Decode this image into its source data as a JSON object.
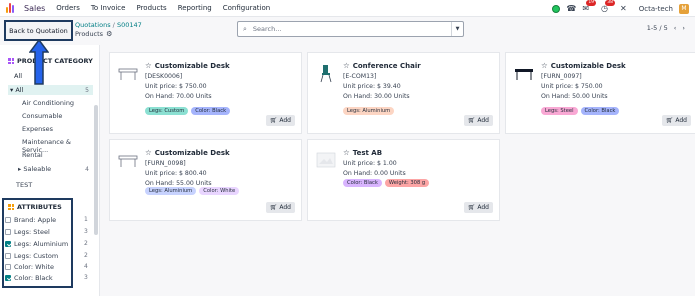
{
  "topbar": {
    "app_name": "Sales",
    "menus": [
      "Orders",
      "To Invoice",
      "Products",
      "Reporting",
      "Configuration"
    ],
    "messages_badge": "19",
    "activity_badge": "38",
    "company": "Octa-tech",
    "avatar_letter": "M"
  },
  "breadcrumb": {
    "parent": "Quotations",
    "separator": "/",
    "current": "S00147",
    "subtitle": "Products"
  },
  "back_button": {
    "label": "Back to Quotation"
  },
  "search": {
    "placeholder": "Search..."
  },
  "pager": {
    "value": "1-5 / 5",
    "prev": "‹",
    "next": "›"
  },
  "sidebar": {
    "category_title": "PRODUCT CATEGORY",
    "categories": [
      {
        "label": "All",
        "count": ""
      },
      {
        "label": "▾ All",
        "count": "5"
      },
      {
        "label": "Air Conditioning",
        "count": ""
      },
      {
        "label": "Consumable",
        "count": ""
      },
      {
        "label": "Expenses",
        "count": ""
      },
      {
        "label": "Maintenance & Servic...",
        "count": ""
      },
      {
        "label": "Rental",
        "count": ""
      },
      {
        "label": "▸ Saleable",
        "count": "4"
      },
      {
        "label": "TEST",
        "count": ""
      }
    ],
    "attributes_title": "ATTRIBUTES",
    "attributes": [
      {
        "label": "Brand: Apple",
        "count": "1",
        "checked": false
      },
      {
        "label": "Legs: Steel",
        "count": "3",
        "checked": false
      },
      {
        "label": "Legs: Aluminium",
        "count": "2",
        "checked": true
      },
      {
        "label": "Legs: Custom",
        "count": "2",
        "checked": false
      },
      {
        "label": "Color: White",
        "count": "4",
        "checked": false
      },
      {
        "label": "Color: Black",
        "count": "3",
        "checked": true
      }
    ]
  },
  "products": [
    {
      "name": "Customizable Desk",
      "ref": "[DESK0006]",
      "price": "Unit price: $ 750.00",
      "onhand": "On Hand: 70.00 Units",
      "tags": [
        {
          "label": "Legs: Custom",
          "color": "#8be0d2"
        },
        {
          "label": "Color: Black",
          "color": "#a5b4fc"
        }
      ],
      "add": "Add",
      "thumb": "desk-white"
    },
    {
      "name": "Conference Chair",
      "ref": "[E-COM13]",
      "price": "Unit price: $ 39.40",
      "onhand": "On Hand: 30.00 Units",
      "tags": [
        {
          "label": "Legs: Aluminium",
          "color": "#fcd5c3"
        }
      ],
      "add": "Add",
      "thumb": "chair"
    },
    {
      "name": "Customizable Desk",
      "ref": "[FURN_0097]",
      "price": "Unit price: $ 750.00",
      "onhand": "On Hand: 50.00 Units",
      "tags": [
        {
          "label": "Legs: Steel",
          "color": "#f9a8d4"
        },
        {
          "label": "Color: Black",
          "color": "#a5b4fc"
        }
      ],
      "add": "Add",
      "thumb": "desk-black"
    },
    {
      "name": "Customizable Desk",
      "ref": "[FURN_0098]",
      "price": "Unit price: $ 800.40",
      "onhand": "On Hand: 55.00 Units",
      "tags": [
        {
          "label": "Legs: Aluminium",
          "color": "#c7d2fe"
        },
        {
          "label": "Color: White",
          "color": "#e9d5ff"
        }
      ],
      "add": "Add",
      "thumb": "desk-white"
    },
    {
      "name": "Test AB",
      "ref": "",
      "price": "Unit price: $ 1.00",
      "onhand": "On Hand: 0.00 Units",
      "tags": [
        {
          "label": "Color: Black",
          "color": "#d8b4fe"
        },
        {
          "label": "Weight: 308 g",
          "color": "#fca5a5"
        }
      ],
      "add": "Add",
      "thumb": "placeholder"
    }
  ],
  "colors": {
    "accent": "#017e84",
    "brand": "#714b67",
    "highlight_border": "#1e3a5f"
  }
}
